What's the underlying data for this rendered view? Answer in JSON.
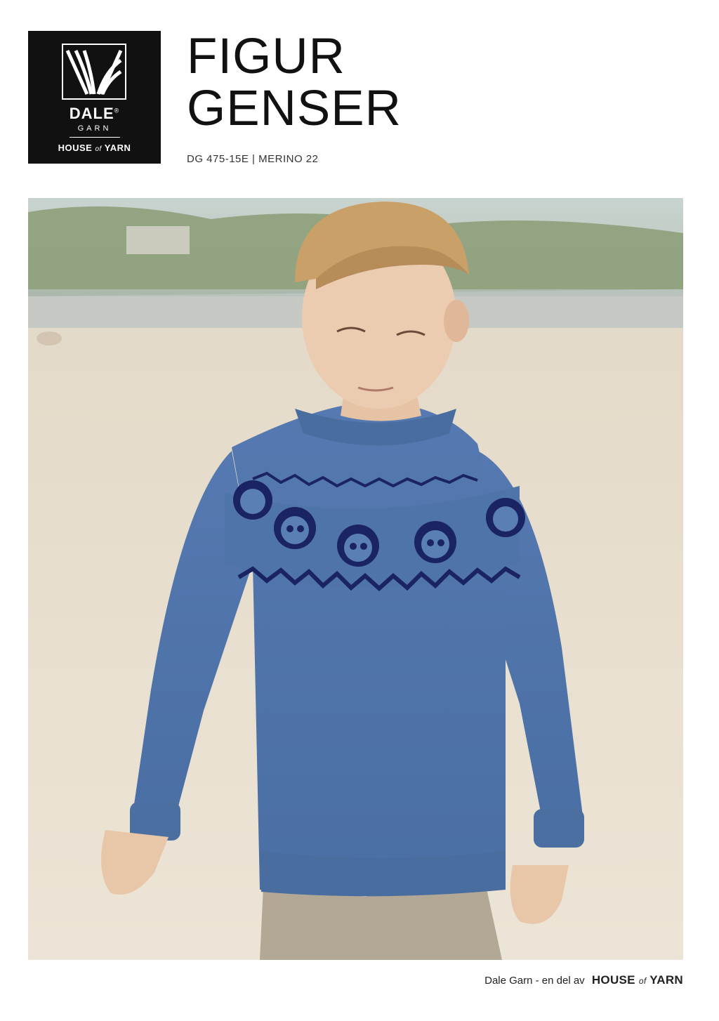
{
  "logo": {
    "brand": "DALE",
    "registered": "®",
    "sub": "GARN",
    "house_part1": "HOUSE",
    "house_of": "of",
    "house_part2": "YARN"
  },
  "title": {
    "line1": "FIGUR",
    "line2": "GENSER"
  },
  "subtitle": "DG 475-15E | MERINO 22",
  "photo": {
    "subject": "child-in-knitted-sweater-on-beach"
  },
  "footer": {
    "text": "Dale Garn - en del av",
    "house_part1": "HOUSE",
    "house_of": "of",
    "house_part2": "YARN"
  },
  "colors": {
    "logo_bg": "#111111",
    "sweater": "#4f77ad",
    "pattern": "#1a2363",
    "sand": "#e6dccb"
  }
}
